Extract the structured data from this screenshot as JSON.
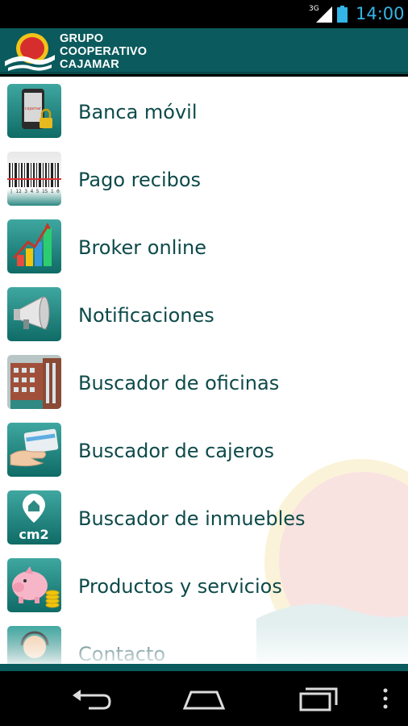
{
  "status": {
    "network": "3G",
    "time": "14:00",
    "clock_color": "#33b5e5"
  },
  "header": {
    "brand_line1": "GRUPO",
    "brand_line2": "COOPERATIVO",
    "brand_line3": "CAJAMAR",
    "background": "#0b5a5d"
  },
  "menu": {
    "items": [
      {
        "label": "Banca móvil",
        "icon": "mobile-banking-icon"
      },
      {
        "label": "Pago recibos",
        "icon": "barcode-icon"
      },
      {
        "label": "Broker online",
        "icon": "bar-chart-icon"
      },
      {
        "label": "Notificaciones",
        "icon": "megaphone-icon"
      },
      {
        "label": "Buscador de oficinas",
        "icon": "office-building-icon"
      },
      {
        "label": "Buscador de cajeros",
        "icon": "card-hand-icon"
      },
      {
        "label": "Buscador de inmuebles",
        "icon": "house-pin-icon"
      },
      {
        "label": "Productos y servicios",
        "icon": "piggy-bank-icon"
      },
      {
        "label": "Contacto",
        "icon": "operator-icon"
      }
    ],
    "mini_texts": {
      "banca_screen": "cajamar",
      "barcode_digits": "| 12 3 4 5 15 1 0",
      "inmuebles_badge": "cm2"
    },
    "text_color": "#0e4a4a"
  },
  "navbar": {
    "back": "back-icon",
    "home": "home-icon",
    "recents": "recents-icon",
    "menu": "overflow-menu-icon"
  }
}
